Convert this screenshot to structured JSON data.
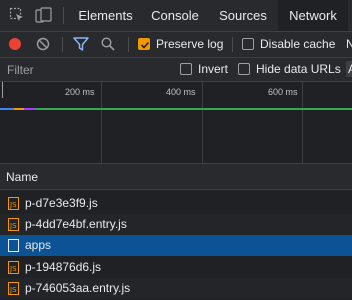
{
  "tabs": [
    {
      "label": "Elements"
    },
    {
      "label": "Console"
    },
    {
      "label": "Sources"
    },
    {
      "label": "Network"
    }
  ],
  "toolbar": {
    "preserve_log": {
      "label": "Preserve log",
      "checked": true
    },
    "disable_cache": {
      "label": "Disable cache",
      "checked": false
    },
    "overflow_letter": "N"
  },
  "filter": {
    "placeholder": "Filter",
    "invert": {
      "label": "Invert",
      "checked": false
    },
    "hide_data_urls": {
      "label": "Hide data URLs",
      "checked": false
    },
    "overflow_letter": "A"
  },
  "overview": {
    "ticks": [
      "200 ms",
      "400 ms",
      "600 ms"
    ]
  },
  "table": {
    "header": "Name",
    "rows": [
      {
        "name": "p-d7e3e3f9.js",
        "type": "script"
      },
      {
        "name": "p-4dd7e4bf.entry.js",
        "type": "script"
      },
      {
        "name": "apps",
        "type": "document"
      },
      {
        "name": "p-194876d6.js",
        "type": "script"
      },
      {
        "name": "p-746053aa.entry.js",
        "type": "script"
      }
    ]
  },
  "colors": {
    "accent": "#8ab4f8",
    "checkbox_checked": "#f29900",
    "record": "#ea4335",
    "selected_row": "#0b5394",
    "timeline_green": "#34a853"
  }
}
